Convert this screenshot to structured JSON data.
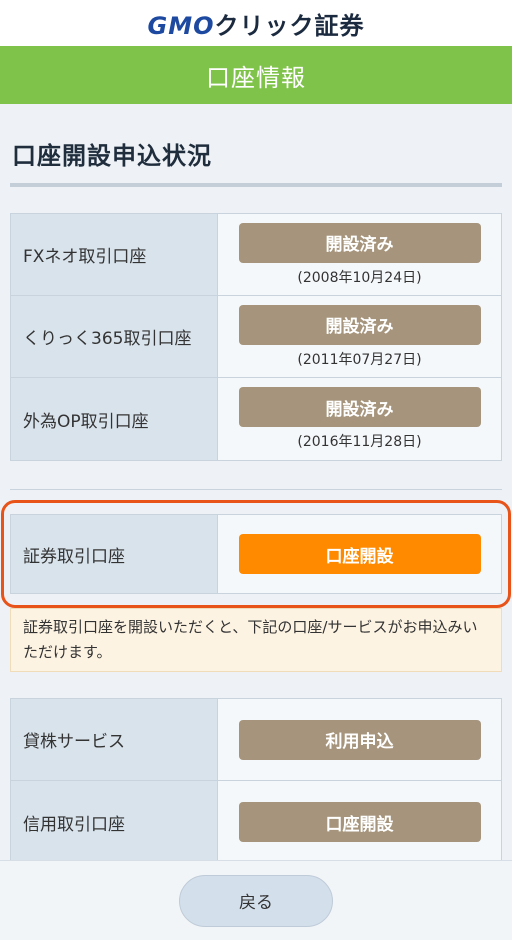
{
  "header": {
    "logo_gmo": "GMO",
    "logo_rest": "クリック証券"
  },
  "title": "口座情報",
  "section": {
    "title": "口座開設申込状況"
  },
  "opened_accounts": [
    {
      "label": "FXネオ取引口座",
      "button": "開設済み",
      "date": "(2008年10月24日)"
    },
    {
      "label": "くりっく365取引口座",
      "button": "開設済み",
      "date": "(2011年07月27日)"
    },
    {
      "label": "外為OP取引口座",
      "button": "開設済み",
      "date": "(2016年11月28日)"
    }
  ],
  "securities": {
    "label": "証券取引口座",
    "button": "口座開設"
  },
  "note": "証券取引口座を開設いただくと、下記の口座/サービスがお申込みいただけます。",
  "services": [
    {
      "label": "貸株サービス",
      "button": "利用申込"
    },
    {
      "label": "信用取引口座",
      "button": "口座開設"
    }
  ],
  "footer": {
    "back": "戻る"
  },
  "colors": {
    "green": "#80c34b",
    "done": "#a6957c",
    "apply": "#ff8a00",
    "highlight": "#e8531a"
  }
}
